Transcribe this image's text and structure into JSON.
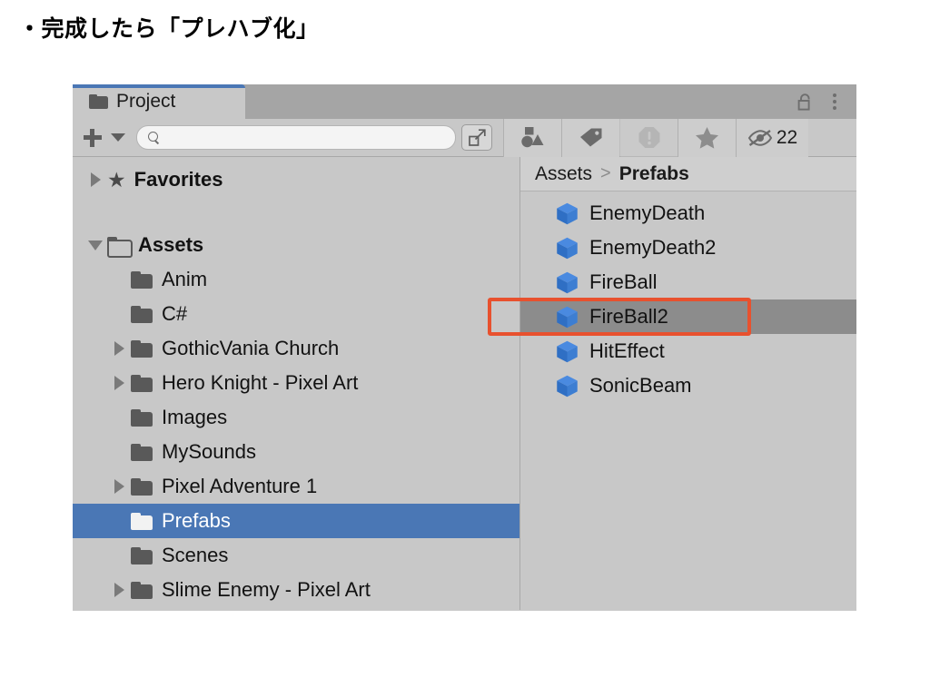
{
  "slide": {
    "heading": "・完成したら「プレハブ化」"
  },
  "window": {
    "tab": {
      "label": "Project",
      "icon": "folder-icon"
    },
    "title_bar_actions": [
      {
        "name": "lock-icon",
        "state": "unlocked"
      },
      {
        "name": "kebab-menu-icon",
        "label": "⋮"
      }
    ]
  },
  "toolbar": {
    "create_button_label": "+",
    "create_dropdown_label": "▾",
    "search": {
      "value": "",
      "placeholder": ""
    },
    "expand_button_name": "expand-collapse-icon",
    "filters": [
      {
        "name": "filter-by-type-icon",
        "label": "shapes"
      },
      {
        "name": "filter-by-label-icon",
        "label": "tag"
      },
      {
        "name": "filter-warnings-icon",
        "label": "warning",
        "dimmed": true
      },
      {
        "name": "filter-favorites-icon",
        "label": "star"
      }
    ],
    "hidden_items": {
      "icon": "eye-slash-icon",
      "count": "22"
    }
  },
  "tree": {
    "items": [
      {
        "label": "Favorites",
        "icon": "star-icon",
        "twisty": "closed",
        "depth": 0,
        "bold": true,
        "selected": false,
        "spacer_after": true
      },
      {
        "label": "Assets",
        "icon": "folder-open-icon",
        "twisty": "open",
        "depth": 0,
        "bold": true,
        "selected": false
      },
      {
        "label": "Anim",
        "icon": "folder-icon",
        "twisty": "none",
        "depth": 1,
        "bold": false,
        "selected": false
      },
      {
        "label": "C#",
        "icon": "folder-icon",
        "twisty": "none",
        "depth": 1,
        "bold": false,
        "selected": false
      },
      {
        "label": "GothicVania Church",
        "icon": "folder-icon",
        "twisty": "closed",
        "depth": 1,
        "bold": false,
        "selected": false
      },
      {
        "label": "Hero Knight - Pixel Art",
        "icon": "folder-icon",
        "twisty": "closed",
        "depth": 1,
        "bold": false,
        "selected": false
      },
      {
        "label": "Images",
        "icon": "folder-icon",
        "twisty": "none",
        "depth": 1,
        "bold": false,
        "selected": false
      },
      {
        "label": "MySounds",
        "icon": "folder-icon",
        "twisty": "none",
        "depth": 1,
        "bold": false,
        "selected": false
      },
      {
        "label": "Pixel Adventure 1",
        "icon": "folder-icon",
        "twisty": "closed",
        "depth": 1,
        "bold": false,
        "selected": false
      },
      {
        "label": "Prefabs",
        "icon": "folder-icon",
        "twisty": "none",
        "depth": 1,
        "bold": false,
        "selected": true
      },
      {
        "label": "Scenes",
        "icon": "folder-icon",
        "twisty": "none",
        "depth": 1,
        "bold": false,
        "selected": false
      },
      {
        "label": "Slime Enemy - Pixel Art",
        "icon": "folder-icon",
        "twisty": "closed",
        "depth": 1,
        "bold": false,
        "selected": false
      }
    ]
  },
  "breadcrumb": {
    "root": "Assets",
    "separator": ">",
    "current": "Prefabs"
  },
  "assets": {
    "items": [
      {
        "label": "EnemyDeath",
        "icon": "prefab-cube-icon",
        "selected": false,
        "annotated": false
      },
      {
        "label": "EnemyDeath2",
        "icon": "prefab-cube-icon",
        "selected": false,
        "annotated": false
      },
      {
        "label": "FireBall",
        "icon": "prefab-cube-icon",
        "selected": false,
        "annotated": false
      },
      {
        "label": "FireBall2",
        "icon": "prefab-cube-icon",
        "selected": true,
        "annotated": true
      },
      {
        "label": "HitEffect",
        "icon": "prefab-cube-icon",
        "selected": false,
        "annotated": false
      },
      {
        "label": "SonicBeam",
        "icon": "prefab-cube-icon",
        "selected": false,
        "annotated": false
      }
    ]
  },
  "colors": {
    "window_bg": "#c8c8c8",
    "tabstrip_bg": "#a5a5a5",
    "tab_accent": "#4a77b5",
    "tree_selection": "#4a77b5",
    "list_selection": "#8c8c8c",
    "annotation_box": "#e8512e",
    "prefab_icon": "#3b7dd8",
    "folder_icon": "#595959",
    "text": "#121212"
  }
}
